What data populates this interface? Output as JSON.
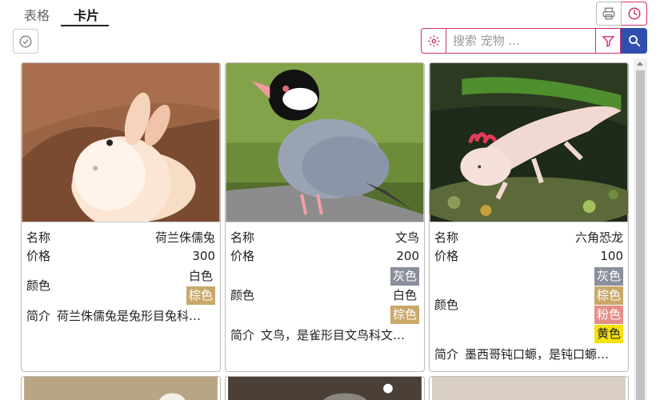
{
  "tabs": [
    {
      "label": "表格",
      "active": false
    },
    {
      "label": "卡片",
      "active": true
    }
  ],
  "toolbar": {
    "print_icon": "printer-icon",
    "history_icon": "clock-icon",
    "select_icon": "check-circle-icon",
    "settings_icon": "gear-icon",
    "filter_icon": "filter-icon",
    "search_icon": "search-icon"
  },
  "search": {
    "placeholder": "搜索 宠物 ...",
    "value": ""
  },
  "colors": {
    "accent": "#d03070",
    "primary": "#2f4fb0"
  },
  "field_labels": {
    "name": "名称",
    "price": "价格",
    "color": "颜色",
    "intro": "简介"
  },
  "cards": [
    {
      "name": "荷兰侏儒兔",
      "price": "300",
      "colors": [
        {
          "label": "白色",
          "style": "plain"
        },
        {
          "label": "棕色",
          "style": "tan"
        }
      ],
      "intro": "荷兰侏儒兔是兔形目兔科…"
    },
    {
      "name": "文鸟",
      "price": "200",
      "colors": [
        {
          "label": "灰色",
          "style": "gray"
        },
        {
          "label": "白色",
          "style": "plain"
        },
        {
          "label": "棕色",
          "style": "tan"
        }
      ],
      "intro": "文鸟，是雀形目文鸟科文…"
    },
    {
      "name": "六角恐龙",
      "price": "100",
      "colors": [
        {
          "label": "灰色",
          "style": "gray"
        },
        {
          "label": "棕色",
          "style": "tan"
        },
        {
          "label": "粉色",
          "style": "pink"
        },
        {
          "label": "黄色",
          "style": "yellow"
        }
      ],
      "intro": "墨西哥钝口螈，是钝口螈…"
    }
  ]
}
